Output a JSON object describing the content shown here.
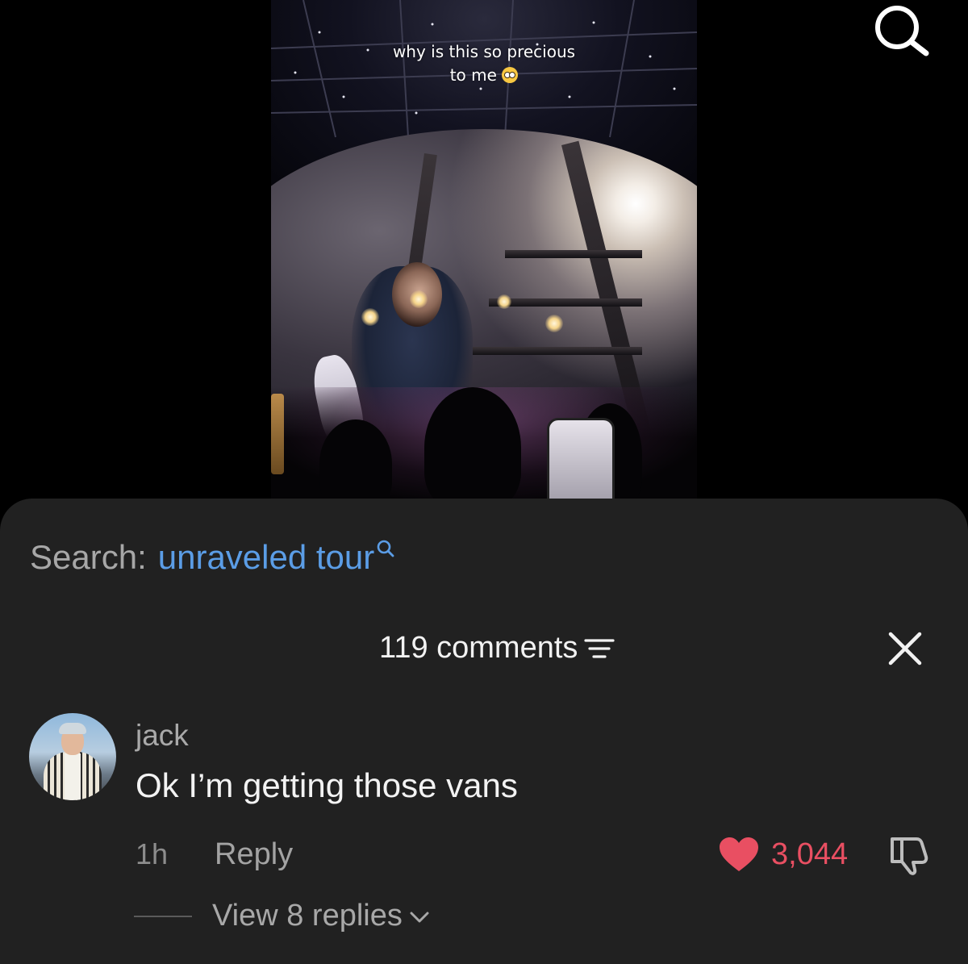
{
  "video": {
    "caption_line1": "why is this so precious",
    "caption_line2": "to me",
    "caption_emoji": "pleading-face-emoji"
  },
  "top_bar": {
    "search_icon": "search-icon"
  },
  "comment_sheet": {
    "search_prefix": "Search:",
    "search_query": "unraveled tour",
    "search_query_color": "#5b9de6",
    "comments_count": "119 comments",
    "sort_icon": "sort-filter-icon",
    "close_icon": "close-icon",
    "comments": [
      {
        "username": "jack",
        "text": "Ok I’m getting those vans",
        "time": "1h",
        "reply_label": "Reply",
        "likes": "3,044",
        "liked": true,
        "like_color": "#e94f62",
        "view_replies": "View 8 replies"
      }
    ]
  }
}
